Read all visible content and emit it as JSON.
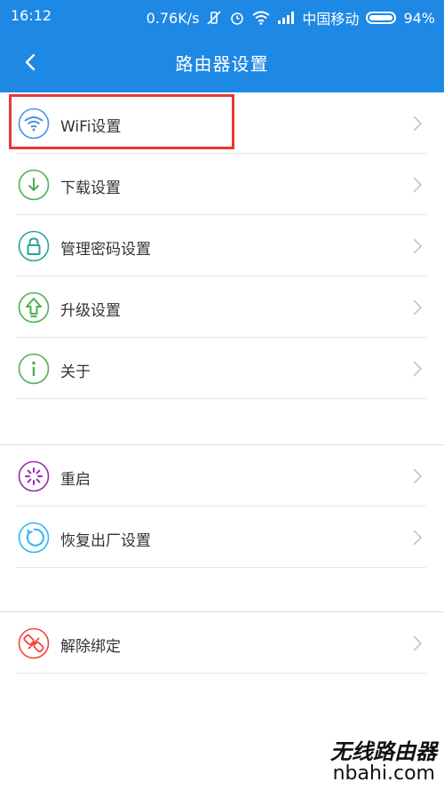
{
  "status_bar": {
    "time": "16:12",
    "speed": "0.76K/s",
    "carrier": "中国移动",
    "battery": "94%"
  },
  "app_bar": {
    "title": "路由器设置"
  },
  "menu": {
    "group1": [
      {
        "label": "WiFi设置",
        "icon": "wifi-icon",
        "color": "#4a90e2"
      },
      {
        "label": "下载设置",
        "icon": "download-icon",
        "color": "#4caf50"
      },
      {
        "label": "管理密码设置",
        "icon": "lock-icon",
        "color": "#26a69a"
      },
      {
        "label": "升级设置",
        "icon": "upgrade-icon",
        "color": "#4caf50"
      },
      {
        "label": "关于",
        "icon": "info-icon",
        "color": "#4caf50"
      }
    ],
    "group2": [
      {
        "label": "重启",
        "icon": "restart-icon",
        "color": "#9c27b0"
      },
      {
        "label": "恢复出厂设置",
        "icon": "reset-icon",
        "color": "#29b6f6"
      }
    ],
    "group3": [
      {
        "label": "解除绑定",
        "icon": "unbind-icon",
        "color": "#f44336"
      }
    ]
  },
  "highlight_color": "#e53935",
  "watermark": {
    "cn": "无线路由器",
    "en": "nbahi.com"
  }
}
